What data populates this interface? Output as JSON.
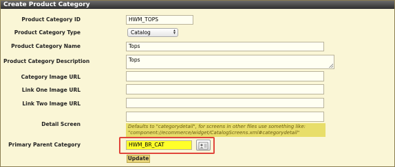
{
  "window": {
    "title": "Create Product Category"
  },
  "form": {
    "fields": [
      {
        "label": "Product Category ID",
        "value": "HWM_TOPS"
      },
      {
        "label": "Product Category Type",
        "value": "Catalog"
      },
      {
        "label": "Product Category Name",
        "value": "Tops"
      },
      {
        "label": "Product Category Description",
        "value": "Tops"
      },
      {
        "label": "Category Image URL",
        "value": ""
      },
      {
        "label": "Link One Image URL",
        "value": ""
      },
      {
        "label": "Link Two Image URL",
        "value": ""
      },
      {
        "label": "Detail Screen",
        "value": ""
      },
      {
        "label": "Primary Parent Category",
        "value": "HWM_BR_CAT"
      }
    ],
    "detail_screen_hint": "Defaults to \"categorydetail\", for screens in other files use something like: \"component://ecommerce/widget/CatalogScreens.xml#categorydetail\"",
    "update_label": "Update"
  },
  "colors": {
    "highlight": "#e0443a",
    "parent_input_bg": "#ffff2a",
    "tooltip_bg": "#e8de6a"
  },
  "icons": {
    "lookup": "lookup-card-icon",
    "select_arrows": "updown-arrows-icon"
  }
}
